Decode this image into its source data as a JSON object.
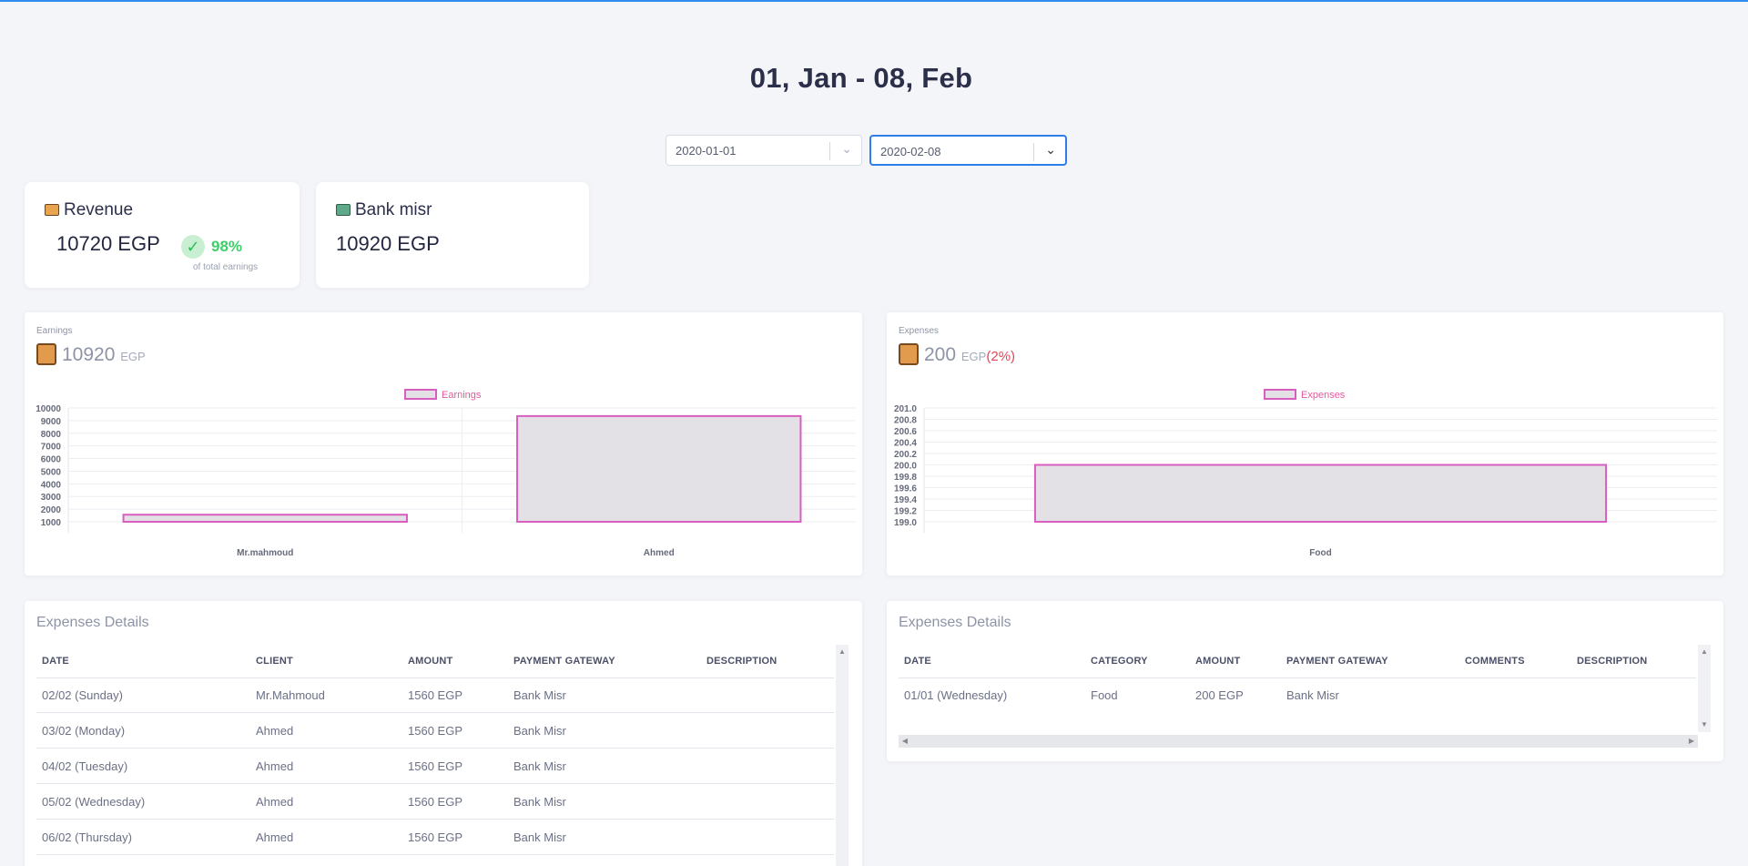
{
  "title": "01, Jan - 08, Feb",
  "filters": {
    "from": "2020-01-01",
    "to": "2020-02-08"
  },
  "stats": {
    "revenue": {
      "label": "Revenue",
      "value": "10720 EGP",
      "percent": "98%",
      "caption": "of total earnings"
    },
    "bank": {
      "label": "Bank misr",
      "value": "10920 EGP"
    }
  },
  "earnings_panel": {
    "label": "Earnings",
    "total": "10920",
    "unit": "EGP",
    "legend": "Earnings"
  },
  "expenses_panel": {
    "label": "Expenses",
    "total": "200",
    "unit": "EGP",
    "share": "(2%)",
    "legend": "Expenses"
  },
  "chart_data": [
    {
      "type": "bar",
      "title": "",
      "categories": [
        "Mr.mahmoud",
        "Ahmed"
      ],
      "series": [
        {
          "name": "Earnings",
          "values": [
            1560,
            9360
          ]
        }
      ],
      "ylim": [
        1000,
        10000
      ],
      "yticks": [
        "10000",
        "9000",
        "8000",
        "7000",
        "6000",
        "5000",
        "4000",
        "3000",
        "2000",
        "1000"
      ],
      "grid": true,
      "legend": "top"
    },
    {
      "type": "bar",
      "title": "",
      "categories": [
        "Food"
      ],
      "series": [
        {
          "name": "Expenses",
          "values": [
            200
          ]
        }
      ],
      "ylim": [
        199.0,
        201.0
      ],
      "yticks": [
        "201.0",
        "200.8",
        "200.6",
        "200.4",
        "200.2",
        "200.0",
        "199.8",
        "199.6",
        "199.4",
        "199.2",
        "199.0"
      ],
      "grid": true,
      "legend": "top"
    }
  ],
  "earnings_table": {
    "title": "Expenses Details",
    "headers": [
      "DATE",
      "CLIENT",
      "AMOUNT",
      "PAYMENT GATEWAY",
      "DESCRIPTION"
    ],
    "rows": [
      [
        "02/02 (Sunday)",
        "Mr.Mahmoud",
        "1560 EGP",
        "Bank Misr",
        ""
      ],
      [
        "03/02 (Monday)",
        "Ahmed",
        "1560 EGP",
        "Bank Misr",
        ""
      ],
      [
        "04/02 (Tuesday)",
        "Ahmed",
        "1560 EGP",
        "Bank Misr",
        ""
      ],
      [
        "05/02 (Wednesday)",
        "Ahmed",
        "1560 EGP",
        "Bank Misr",
        ""
      ],
      [
        "06/02 (Thursday)",
        "Ahmed",
        "1560 EGP",
        "Bank Misr",
        ""
      ]
    ]
  },
  "expenses_table": {
    "title": "Expenses Details",
    "headers": [
      "DATE",
      "CATEGORY",
      "AMOUNT",
      "PAYMENT GATEWAY",
      "COMMENTS",
      "DESCRIPTION"
    ],
    "rows": [
      [
        "01/01 (Wednesday)",
        "Food",
        "200 EGP",
        "Bank Misr",
        "",
        ""
      ]
    ]
  },
  "colors": {
    "accent": "#2f8df0",
    "bar_fill": "#e3e1e5",
    "bar_border": "#d85fc0",
    "positive": "#3fcf6a",
    "negative": "#e0455a"
  }
}
